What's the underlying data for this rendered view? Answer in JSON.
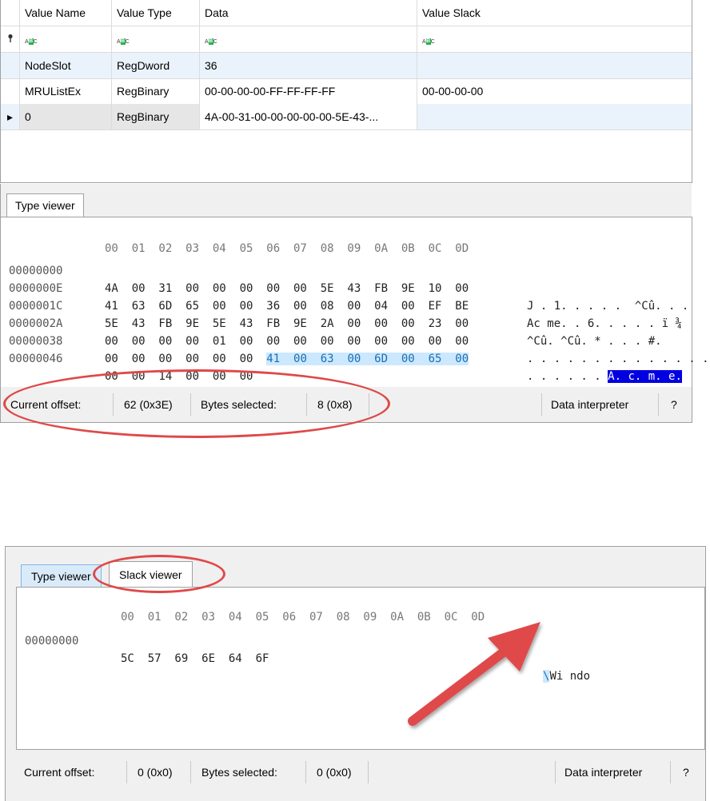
{
  "table": {
    "columns": [
      "Value Name",
      "Value Type",
      "Data",
      "Value Slack"
    ],
    "filter_icon": "pin-icon",
    "filter_glyph": "ABC",
    "rows": [
      {
        "name": "NodeSlot",
        "type": "RegDword",
        "data": "36",
        "slack": ""
      },
      {
        "name": "MRUListEx",
        "type": "RegBinary",
        "data": "00-00-00-00-FF-FF-FF-FF",
        "slack": "00-00-00-00"
      },
      {
        "name": "0",
        "type": "RegBinary",
        "data": "4A-00-31-00-00-00-00-00-5E-43-...",
        "slack": "",
        "marker": "▸"
      }
    ]
  },
  "top": {
    "tab_label": "Type viewer",
    "column_header": "00  01  02  03  04  05  06  07  08  09  0A  0B  0C  0D",
    "rows": [
      {
        "offset": "00000000",
        "bytes": "4A  00  31  00  00  00  00  00  5E  43  FB  9E  10  00",
        "ascii": "J . 1. . . . .  ^Cû. . ."
      },
      {
        "offset": "0000000E",
        "bytes": "41  63  6D  65  00  00  36  00  08  00  04  00  EF  BE",
        "ascii": "Ac me. . 6. . . . . ï ¾"
      },
      {
        "offset": "0000001C",
        "bytes": "5E  43  FB  9E  5E  43  FB  9E  2A  00  00  00  23  00",
        "ascii": "^Cû. ^Cû. * . . . #."
      },
      {
        "offset": "0000002A",
        "bytes": "00  00  00  00  01  00  00  00  00  00  00  00  00  00",
        "ascii": ". . . . . . . . . . . . . ."
      },
      {
        "offset": "00000038",
        "bytes_plain": "00  00  00  00  00  00  ",
        "bytes_hl": "41  00  63  00  6D  00  65  00",
        "ascii_plain": ". . . . . . ",
        "ascii_hl": "A. c. m. e."
      },
      {
        "offset": "00000046",
        "bytes": "00  00  14  00  00  00",
        "ascii": ". . . . . ."
      }
    ],
    "status": {
      "offset_label": "Current offset:",
      "offset_value": "62 (0x3E)",
      "selected_label": "Bytes selected:",
      "selected_value": "8 (0x8)",
      "interpreter_label": "Data interpreter",
      "help_label": "?"
    }
  },
  "bottom": {
    "tabs": [
      "Type viewer",
      "Slack viewer"
    ],
    "column_header": "00  01  02  03  04  05  06  07  08  09  0A  0B  0C  0D",
    "rows": [
      {
        "offset": "00000000",
        "bytes": "5C  57  69  6E  64  6F",
        "ascii_hl": "\\",
        "ascii": "Wi ndo"
      }
    ],
    "status": {
      "offset_label": "Current offset:",
      "offset_value": "0 (0x0)",
      "selected_label": "Bytes selected:",
      "selected_value": "0 (0x0)",
      "interpreter_label": "Data interpreter",
      "help_label": "?"
    }
  },
  "annotation_color": "#e04848"
}
